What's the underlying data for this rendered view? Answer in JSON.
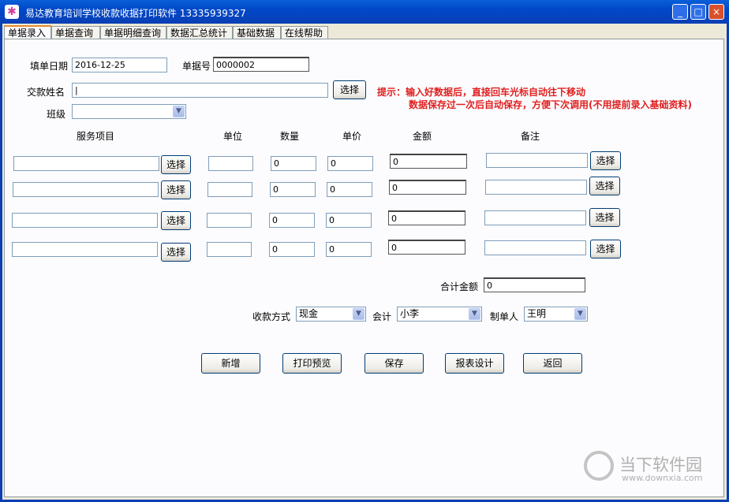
{
  "window": {
    "title": "易达教育培训学校收款收据打印软件 13335939327",
    "min": "_",
    "max": "□",
    "close": "×"
  },
  "tabs": [
    "单据录入",
    "单据查询",
    "单据明细查询",
    "数据汇总统计",
    "基础数据",
    "在线帮助"
  ],
  "form": {
    "date_label": "填单日期",
    "date_value": "2016-12-25",
    "no_label": "单据号",
    "no_value": "0000002",
    "payer_label": "交款姓名",
    "payer_value": "|",
    "class_label": "班级",
    "class_value": "",
    "select_label": "选择"
  },
  "hint": {
    "line1": "提示：输入好数据后，直接回车光标自动往下移动",
    "line2": "数据保存过一次后自动保存，方便下次调用(不用提前录入基础资料)"
  },
  "columns": {
    "service": "服务项目",
    "unit": "单位",
    "qty": "数量",
    "price": "单价",
    "amount": "金额",
    "remark": "备注"
  },
  "rows": [
    {
      "service": "",
      "unit": "",
      "qty": "0",
      "price": "0",
      "amount": "0",
      "remark": ""
    },
    {
      "service": "",
      "unit": "",
      "qty": "0",
      "price": "0",
      "amount": "0",
      "remark": ""
    },
    {
      "service": "",
      "unit": "",
      "qty": "0",
      "price": "0",
      "amount": "0",
      "remark": ""
    },
    {
      "service": "",
      "unit": "",
      "qty": "0",
      "price": "0",
      "amount": "0",
      "remark": ""
    }
  ],
  "total": {
    "label": "合计金额",
    "value": "0"
  },
  "payment": {
    "method_label": "收款方式",
    "method_value": "现金",
    "accountant_label": "会计",
    "accountant_value": "小李",
    "maker_label": "制单人",
    "maker_value": "王明"
  },
  "actions": {
    "new": "新增",
    "preview": "打印预览",
    "save": "保存",
    "design": "报表设计",
    "back": "返回"
  },
  "watermark": {
    "text": "当下软件园",
    "url": "www.downxia.com"
  }
}
